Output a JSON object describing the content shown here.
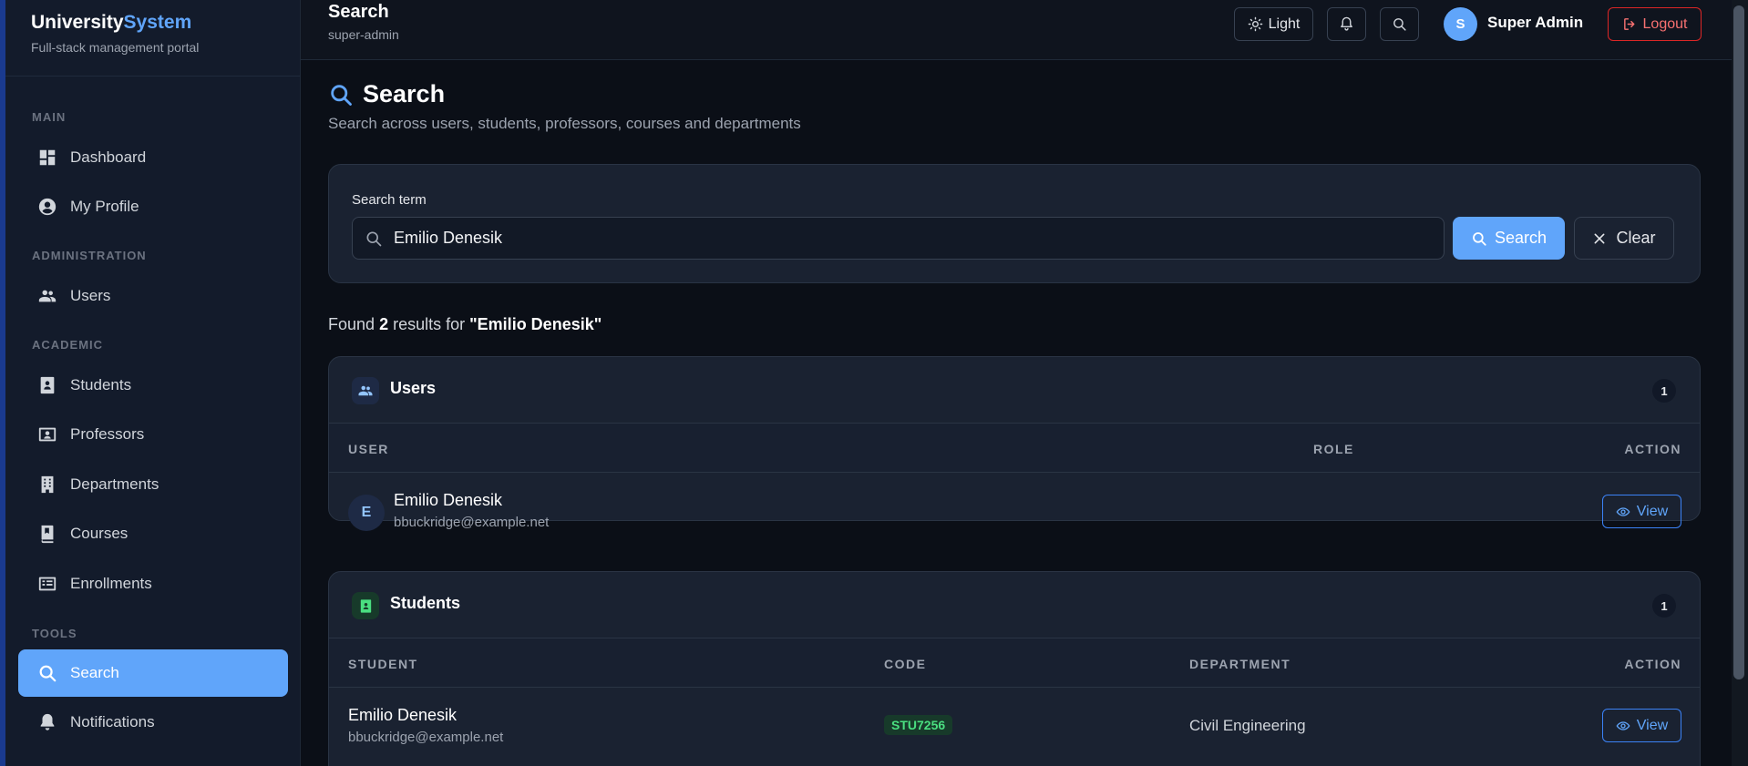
{
  "sidebar": {
    "brand_a": "University",
    "brand_b": "System",
    "subtitle": "Full-stack management portal",
    "sections": {
      "main": "MAIN",
      "administration": "ADMINISTRATION",
      "academic": "ACADEMIC",
      "tools": "TOOLS"
    },
    "items": {
      "dashboard": "Dashboard",
      "profile": "My Profile",
      "users": "Users",
      "students": "Students",
      "professors": "Professors",
      "departments": "Departments",
      "courses": "Courses",
      "enrollments": "Enrollments",
      "search": "Search",
      "notifications": "Notifications"
    },
    "active_item": "search"
  },
  "topbar": {
    "title": "Search",
    "subtitle": "super-admin",
    "theme_label": "Light",
    "avatar_letter": "S",
    "user_name": "Super Admin",
    "logout_label": "Logout"
  },
  "page": {
    "title": "Search",
    "description": "Search across users, students, professors, courses and departments"
  },
  "search": {
    "label": "Search term",
    "value": "Emilio Denesik",
    "search_button": "Search",
    "clear_button": "Clear"
  },
  "results": {
    "prefix": "Found",
    "count": "2",
    "middle": "results for",
    "query": "\"Emilio Denesik\""
  },
  "users_section": {
    "title": "Users",
    "count": "1",
    "headers": {
      "user": "USER",
      "role": "ROLE",
      "action": "ACTION"
    },
    "rows": [
      {
        "initial": "E",
        "name": "Emilio Denesik",
        "email": "bbuckridge@example.net",
        "role": "",
        "action": "View"
      }
    ]
  },
  "students_section": {
    "title": "Students",
    "count": "1",
    "headers": {
      "student": "STUDENT",
      "code": "CODE",
      "department": "DEPARTMENT",
      "action": "ACTION"
    },
    "rows": [
      {
        "name": "Emilio Denesik",
        "email": "bbuckridge@example.net",
        "code": "STU7256",
        "department": "Civil Engineering",
        "action": "View"
      }
    ]
  },
  "colors": {
    "accent": "#60a5fa",
    "background": "#0b0f17",
    "sidebar": "#131b2b",
    "card": "#1a2231",
    "danger": "#f87171",
    "success": "#4ade80"
  }
}
